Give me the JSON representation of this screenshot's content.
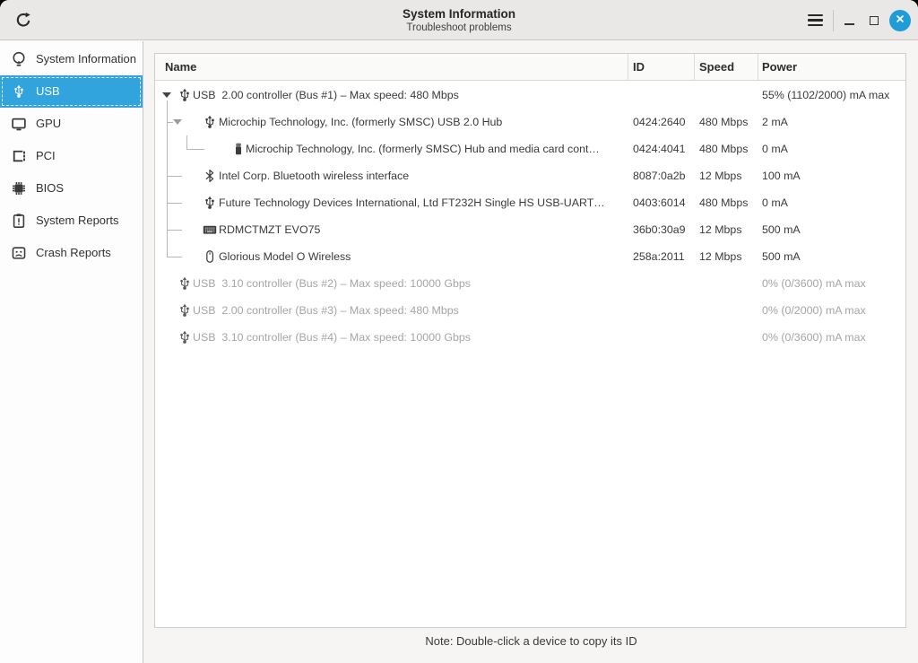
{
  "window": {
    "title": "System Information",
    "subtitle": "Troubleshoot problems"
  },
  "titlebar": {
    "refresh_icon": "refresh",
    "menu_icon": "hamburger-menu",
    "minimize_icon": "minimize",
    "maximize_icon": "maximize",
    "close_icon": "close"
  },
  "sidebar": {
    "items": [
      {
        "label": "System Information",
        "icon": "lightbulb",
        "selected": false
      },
      {
        "label": "USB",
        "icon": "usb",
        "selected": true
      },
      {
        "label": "GPU",
        "icon": "display",
        "selected": false
      },
      {
        "label": "PCI",
        "icon": "pci-card",
        "selected": false
      },
      {
        "label": "BIOS",
        "icon": "chip",
        "selected": false
      },
      {
        "label": "System Reports",
        "icon": "clipboard-report",
        "selected": false
      },
      {
        "label": "Crash Reports",
        "icon": "crash-face",
        "selected": false
      }
    ]
  },
  "table": {
    "columns": [
      "Name",
      "ID",
      "Speed",
      "Power"
    ],
    "rows": [
      {
        "name": "USB  2.00 controller (Bus #1) – Max speed: 480 Mbps",
        "id": "",
        "speed": "",
        "power": "55% (1102/2000) mA max",
        "level": 0,
        "icon": "usb",
        "expander": true,
        "dimmed": false
      },
      {
        "name": "Microchip Technology, Inc. (formerly SMSC) USB 2.0 Hub",
        "id": "0424:2640",
        "speed": "480 Mbps",
        "power": "2 mA",
        "level": 1,
        "icon": "usb",
        "expander": true,
        "dimmed": false
      },
      {
        "name": "Microchip Technology, Inc. (formerly SMSC) Hub and media card cont…",
        "id": "0424:4041",
        "speed": "480 Mbps",
        "power": "0 mA",
        "level": 2,
        "icon": "flash-drive",
        "expander": false,
        "dimmed": false
      },
      {
        "name": "Intel Corp. Bluetooth wireless interface",
        "id": "8087:0a2b",
        "speed": "12 Mbps",
        "power": "100 mA",
        "level": 1,
        "icon": "bluetooth",
        "expander": false,
        "dimmed": false
      },
      {
        "name": "Future Technology Devices International, Ltd FT232H Single HS USB-UART…",
        "id": "0403:6014",
        "speed": "480 Mbps",
        "power": "0 mA",
        "level": 1,
        "icon": "usb",
        "expander": false,
        "dimmed": false
      },
      {
        "name": "RDMCTMZT EVO75",
        "id": "36b0:30a9",
        "speed": "12 Mbps",
        "power": "500 mA",
        "level": 1,
        "icon": "keyboard",
        "expander": false,
        "dimmed": false
      },
      {
        "name": "Glorious Model O Wireless",
        "id": "258a:2011",
        "speed": "12 Mbps",
        "power": "500 mA",
        "level": 1,
        "icon": "mouse",
        "expander": false,
        "dimmed": false
      },
      {
        "name": "USB  3.10 controller (Bus #2) – Max speed: 10000 Gbps",
        "id": "",
        "speed": "",
        "power": "0% (0/3600) mA max",
        "level": 0,
        "icon": "usb",
        "expander": false,
        "dimmed": true
      },
      {
        "name": "USB  2.00 controller (Bus #3) – Max speed: 480 Mbps",
        "id": "",
        "speed": "",
        "power": "0% (0/2000) mA max",
        "level": 0,
        "icon": "usb",
        "expander": false,
        "dimmed": true
      },
      {
        "name": "USB  3.10 controller (Bus #4) – Max speed: 10000 Gbps",
        "id": "",
        "speed": "",
        "power": "0% (0/3600) mA max",
        "level": 0,
        "icon": "usb",
        "expander": false,
        "dimmed": true
      }
    ]
  },
  "footer": {
    "note": "Note: Double-click a device to copy its ID"
  },
  "colors": {
    "accent_blue": "#31a4dd",
    "close_button_blue": "#209cd8",
    "titlebar_bg": "#e9e8e6",
    "dimmed_text": "#a6a5a3",
    "selected_text": "#ffffff"
  }
}
